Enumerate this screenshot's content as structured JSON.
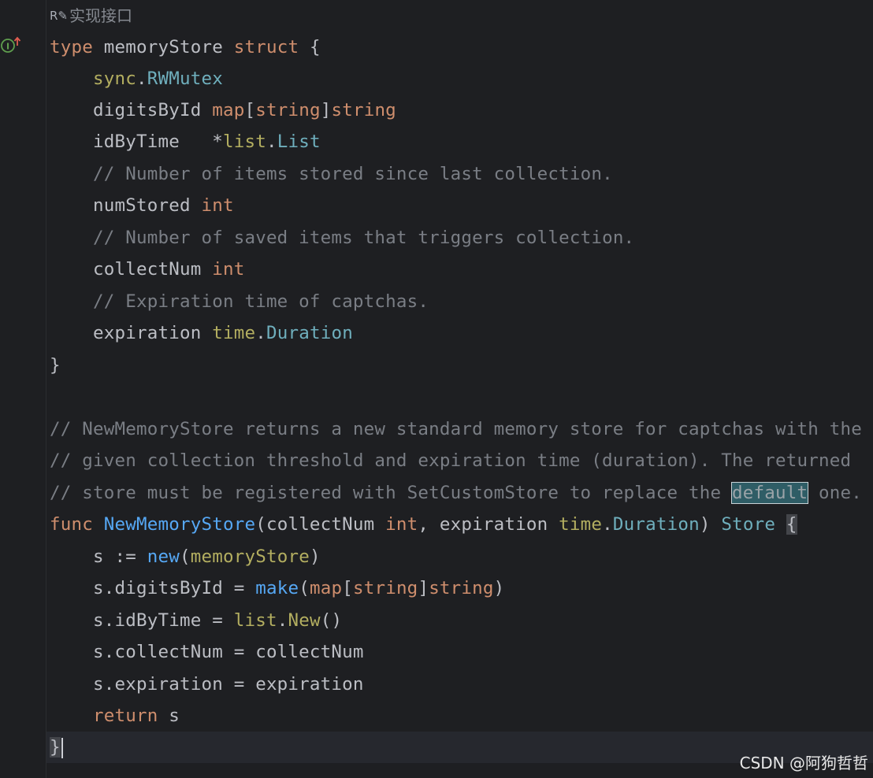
{
  "hint": {
    "label": "实现接口"
  },
  "code": {
    "l1": [
      "type",
      "memoryStore",
      "struct",
      "{"
    ],
    "l2": [
      "sync",
      ".",
      "RWMutex"
    ],
    "l3": [
      "digitsById",
      "map",
      "[",
      "string",
      "]",
      "string"
    ],
    "l4": [
      "idByTime",
      "*",
      "list",
      ".",
      "List"
    ],
    "l5": "// Number of items stored since last collection.",
    "l6": [
      "numStored",
      "int"
    ],
    "l7": "// Number of saved items that triggers collection.",
    "l8": [
      "collectNum",
      "int"
    ],
    "l9": "// Expiration time of captchas.",
    "l10": [
      "expiration",
      "time",
      ".",
      "Duration"
    ],
    "l11": "}",
    "l12": "// NewMemoryStore returns a new standard memory store for captchas with the",
    "l13": "// given collection threshold and expiration time (duration). The returned",
    "l14": [
      "// store must be registered with SetCustomStore to replace the ",
      "default",
      " one."
    ],
    "l15": [
      "func",
      "NewMemoryStore",
      "(collectNum ",
      "int",
      ", expiration ",
      "time",
      ".",
      "Duration",
      ") ",
      "Store",
      " ",
      "{"
    ],
    "l16": [
      "s := ",
      "new",
      "(",
      "memoryStore",
      ")"
    ],
    "l17": [
      "s.digitsById = ",
      "make",
      "(",
      "map",
      "[",
      "string",
      "]",
      "string",
      ")"
    ],
    "l18": [
      "s.idByTime = ",
      "list",
      ".",
      "New",
      "()"
    ],
    "l19": "s.collectNum = collectNum",
    "l20": "s.expiration = expiration",
    "l21": [
      "return",
      " s"
    ],
    "l22": "}"
  },
  "watermark": "CSDN @阿狗哲哲",
  "colors": {
    "background": "#1e1f22",
    "keyword": "#cf8e6d",
    "comment": "#7a7e85",
    "function": "#56a8f5",
    "type": "#6fafbd",
    "package": "#b3ae60",
    "text": "#bcbec4"
  },
  "icons": {
    "gutter": "implemented-interface-icon",
    "hint": "reference-edit-icon"
  }
}
